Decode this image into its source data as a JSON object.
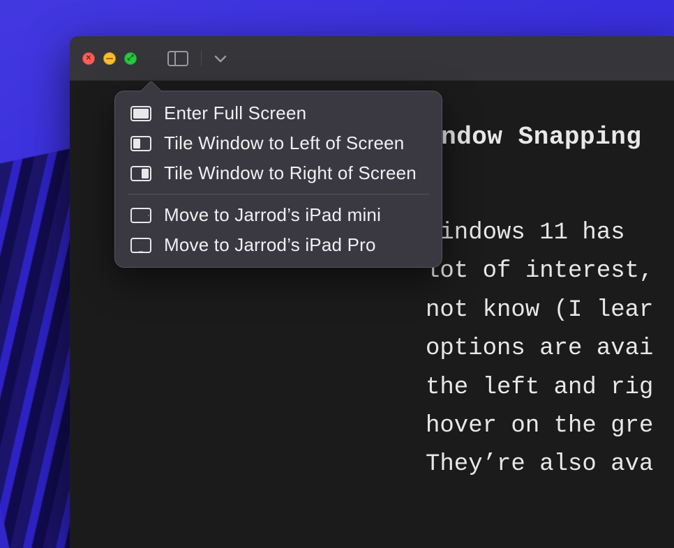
{
  "menu": {
    "items": [
      {
        "label": "Enter Full Screen",
        "icon": "fullscreen"
      },
      {
        "label": "Tile Window to Left of Screen",
        "icon": "tile-left"
      },
      {
        "label": "Tile Window to Right of Screen",
        "icon": "tile-right"
      }
    ],
    "devices": [
      {
        "label": "Move to Jarrod’s iPad mini",
        "icon": "ipad"
      },
      {
        "label": "Move to Jarrod’s iPad Pro",
        "icon": "ipad"
      }
    ]
  },
  "document": {
    "heading_visible": "indow Snapping",
    "body_lines": [
      "Windows 11 has ",
      "lot of interest,",
      "not know (I lear",
      "options are avai",
      "the left and rig",
      "hover on the gre",
      "They’re also ava"
    ]
  },
  "colors": {
    "window_bg": "#1e1e1e",
    "titlebar_bg": "#36353a",
    "popover_bg": "#3a3840",
    "desktop_accent": "#3a2fdd",
    "traffic_close": "#ff5f57",
    "traffic_min": "#febc2e",
    "traffic_zoom": "#28c840"
  }
}
